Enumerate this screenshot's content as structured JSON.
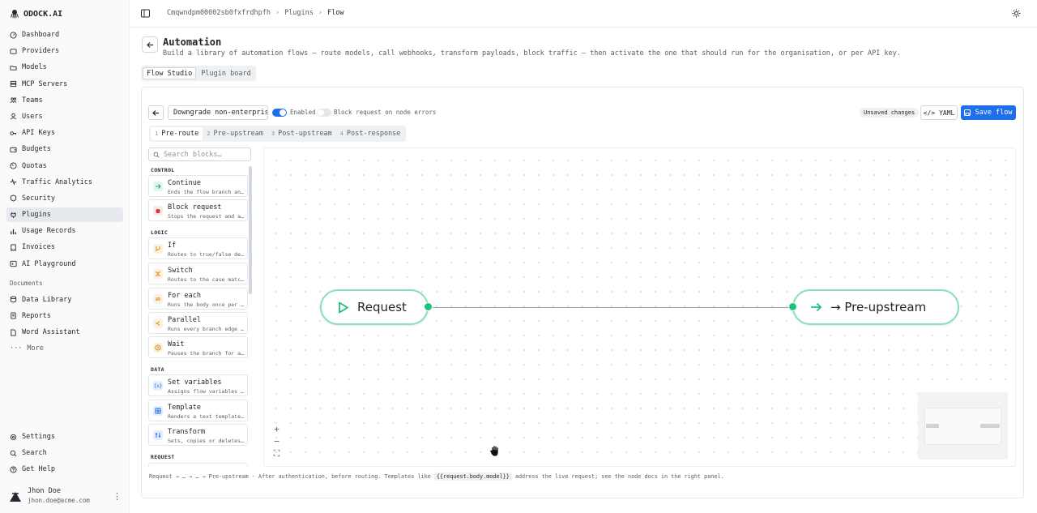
{
  "brand": {
    "name": "ODOCK.AI"
  },
  "sidebar": {
    "items": [
      {
        "label": "Dashboard",
        "icon": "dashboard-icon"
      },
      {
        "label": "Providers",
        "icon": "providers-icon"
      },
      {
        "label": "Models",
        "icon": "folder-icon"
      },
      {
        "label": "MCP Servers",
        "icon": "server-icon"
      },
      {
        "label": "Teams",
        "icon": "teams-icon"
      },
      {
        "label": "Users",
        "icon": "users-icon"
      },
      {
        "label": "API Keys",
        "icon": "key-icon"
      },
      {
        "label": "Budgets",
        "icon": "wallet-icon"
      },
      {
        "label": "Quotas",
        "icon": "gauge-icon"
      },
      {
        "label": "Traffic Analytics",
        "icon": "activity-icon"
      },
      {
        "label": "Security",
        "icon": "shield-icon"
      },
      {
        "label": "Plugins",
        "icon": "plug-icon"
      },
      {
        "label": "Usage Records",
        "icon": "bar-chart-icon"
      },
      {
        "label": "Invoices",
        "icon": "receipt-icon"
      },
      {
        "label": "AI Playground",
        "icon": "terminal-icon"
      }
    ],
    "documents_label": "Documents",
    "doc_items": [
      {
        "label": "Data Library",
        "icon": "database-icon"
      },
      {
        "label": "Reports",
        "icon": "report-icon"
      },
      {
        "label": "Word Assistant",
        "icon": "file-icon"
      }
    ],
    "more_label": "More",
    "bottom_items": [
      {
        "label": "Settings",
        "icon": "gear-icon"
      },
      {
        "label": "Search",
        "icon": "search-icon"
      },
      {
        "label": "Get Help",
        "icon": "help-icon"
      }
    ],
    "user": {
      "name": "Jhon Doe",
      "email": "jhon.doe@acme.com"
    }
  },
  "breadcrumb": {
    "items": [
      "Cmqwndpm00002sb0fxfrdhpfh",
      "Plugins",
      "Flow"
    ]
  },
  "header": {
    "title": "Automation",
    "subtitle": "Build a library of automation flows — route models, call webhooks, transform payloads, block traffic — then activate the one that should run for the organisation, or per API key."
  },
  "view_tabs": [
    "Flow Studio",
    "Plugin board"
  ],
  "toolbar": {
    "flow_name": "Downgrade non-enterprise",
    "enabled_label": "Enabled",
    "block_label": "Block request on node errors",
    "unsaved_label": "Unsaved changes",
    "yaml_label": "YAML",
    "save_label": "Save flow"
  },
  "phase_tabs": [
    {
      "num": "1",
      "label": "Pre-route"
    },
    {
      "num": "2",
      "label": "Pre-upstream"
    },
    {
      "num": "3",
      "label": "Post-upstream"
    },
    {
      "num": "4",
      "label": "Post-response"
    }
  ],
  "palette": {
    "search_placeholder": "Search blocks…",
    "sections": {
      "control": "CONTROL",
      "logic": "LOGIC",
      "data": "DATA",
      "request": "REQUEST"
    },
    "blocks": {
      "continue": {
        "title": "Continue",
        "desc": "Ends the flow branch and continues"
      },
      "block": {
        "title": "Block request",
        "desc": "Stops the request and answers"
      },
      "if": {
        "title": "If",
        "desc": "Routes to true/false depending"
      },
      "switch": {
        "title": "Switch",
        "desc": "Routes to the case matching"
      },
      "foreach": {
        "title": "For each",
        "desc": "Runs the body once per item"
      },
      "parallel": {
        "title": "Parallel",
        "desc": "Runs every branch edge concurrently"
      },
      "wait": {
        "title": "Wait",
        "desc": "Pauses the branch for a duration"
      },
      "setvars": {
        "title": "Set variables",
        "desc": "Assigns flow variables using"
      },
      "template": {
        "title": "Template",
        "desc": "Renders a text template into"
      },
      "transform": {
        "title": "Transform",
        "desc": "Sets, copies or deletes fields"
      }
    }
  },
  "canvas": {
    "nodes": {
      "request": "Request",
      "pre_upstream": "→ Pre-upstream"
    }
  },
  "footer": {
    "pre": "Request → … → … → Pre-upstream · After authentication, before routing. Templates like",
    "code": "{{request.body.model}}",
    "post": "address the live request; see the node docs in the right panel."
  },
  "colors": {
    "accent": "#1f6feb",
    "node_border": "#86e0b8",
    "handle": "#1fc17b"
  }
}
